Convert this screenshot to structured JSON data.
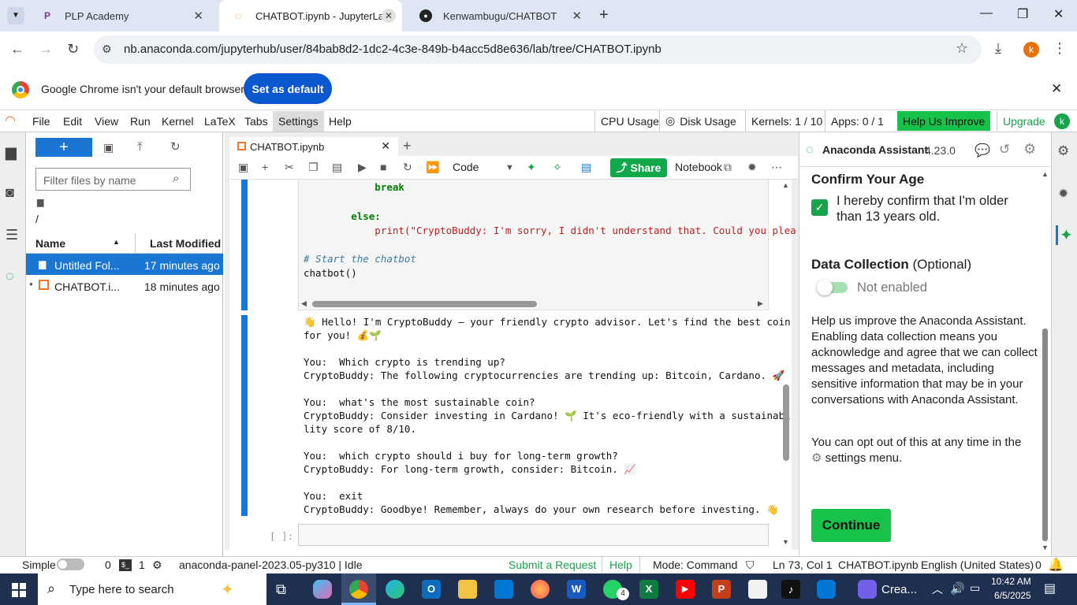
{
  "browser": {
    "tabs": [
      {
        "title": "PLP Academy",
        "icon": "plp-icon"
      },
      {
        "title": "CHATBOT.ipynb - JupyterLab",
        "icon": "jupyter-icon"
      },
      {
        "title": "Kenwambugu/CHATBOT",
        "icon": "github-icon"
      }
    ],
    "url": "nb.anaconda.com/jupyterhub/user/84bab8d2-1dc2-4c3e-849b-b4acc5d8e636/lab/tree/CHATBOT.ipynb",
    "profile_letter": "k"
  },
  "infobar": {
    "message": "Google Chrome isn't your default browser",
    "button": "Set as default"
  },
  "menu": {
    "items": [
      "File",
      "Edit",
      "View",
      "Run",
      "Kernel",
      "LaTeX",
      "Tabs",
      "Settings",
      "Help"
    ],
    "cpu": "CPU Usage",
    "disk": "Disk Usage",
    "kernels": "Kernels: 1 / 10",
    "apps": "Apps: 0 / 1",
    "help_improve": "Help Us Improve",
    "upgrade": "Upgrade",
    "user_letter": "k"
  },
  "filebrowser": {
    "filter_placeholder": "Filter files by name",
    "path": "/",
    "col_name": "Name",
    "col_modified": "Last Modified",
    "files": [
      {
        "name": "Untitled Fol...",
        "modified": "17 minutes ago"
      },
      {
        "name": "CHATBOT.i...",
        "modified": "18 minutes ago"
      }
    ]
  },
  "notebook": {
    "tab_title": "CHATBOT.ipynb",
    "cell_type": "Code",
    "share": "Share",
    "notebook_label": "Notebook",
    "code_lines": [
      "            break",
      "",
      "        else:",
      "            print(\"CryptoBuddy: I'm sorry, I didn't understand that. Could you plea",
      "",
      "# Start the chatbot",
      "chatbot()"
    ],
    "output_lines": [
      "👋 Hello! I'm CryptoBuddy — your friendly crypto advisor. Let's find the best coin",
      "for you! 💰🌱",
      "",
      "You:  Which crypto is trending up?",
      "CryptoBuddy: The following cryptocurrencies are trending up: Bitcoin, Cardano. 🚀",
      "",
      "You:  what's the most sustainable coin?",
      "CryptoBuddy: Consider investing in Cardano! 🌱 It's eco-friendly with a sustainabi",
      "lity score of 8/10.",
      "",
      "You:  which crypto should i buy for long-term growth?",
      "CryptoBuddy: For long-term growth, consider: Bitcoin. 📈",
      "",
      "You:  exit",
      "CryptoBuddy: Goodbye! Remember, always do your own research before investing. 👋"
    ],
    "empty_prompt": "[ ]:"
  },
  "assistant": {
    "title": "Anaconda Assistant",
    "version": "4.23.0",
    "age_heading": "Confirm Your Age",
    "age_text": "I hereby confirm that I'm older than 13 years old.",
    "data_heading": "Data Collection",
    "data_optional": "(Optional)",
    "toggle_label": "Not enabled",
    "para1": "Help us improve the Anaconda Assistant. Enabling data collection means you acknowledge and agree that we can collect messages and metadata, including sensitive information that may be in your conversations with Anaconda Assistant.",
    "para2_a": "You can opt out of this at any time in the",
    "para2_b": "settings menu.",
    "continue": "Continue"
  },
  "status": {
    "simple": "Simple",
    "count0": "0",
    "count1": "1",
    "kernel": "anaconda-panel-2023.05-py310 | Idle",
    "submit": "Submit a Request",
    "help": "Help",
    "mode": "Mode: Command",
    "position": "Ln 73, Col 1",
    "file": "CHATBOT.ipynb",
    "language": "English (United States)",
    "notif": "0"
  },
  "taskbar": {
    "search": "Type here to search",
    "creat": "Crea...",
    "time": "10:42 AM",
    "date": "6/5/2025",
    "whatsapp_badge": "4"
  },
  "colors": {
    "accent_blue": "#1976d2",
    "anaconda_green": "#17c24a",
    "chrome_blue": "#0b57d0"
  }
}
